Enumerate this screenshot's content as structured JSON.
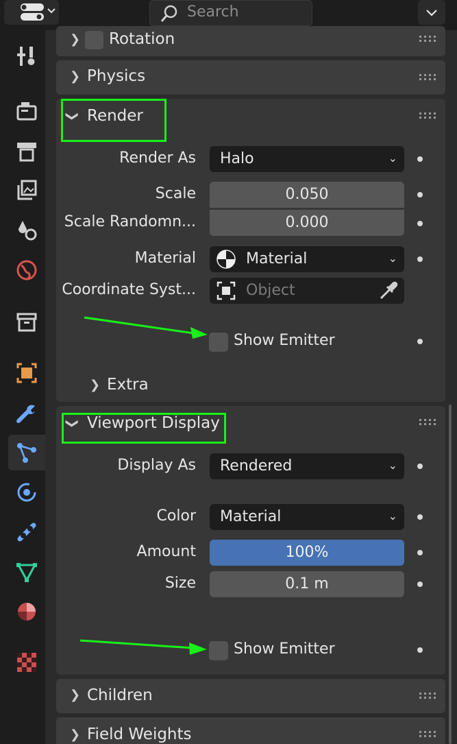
{
  "header": {
    "search_placeholder": "Search"
  },
  "tabs": [
    {
      "name": "tool"
    },
    {
      "name": "render"
    },
    {
      "name": "output"
    },
    {
      "name": "view-layer"
    },
    {
      "name": "scene"
    },
    {
      "name": "world"
    },
    {
      "name": "collection"
    },
    {
      "name": "object"
    },
    {
      "name": "modifiers"
    },
    {
      "name": "particles",
      "active": true
    },
    {
      "name": "physics"
    },
    {
      "name": "constraints"
    },
    {
      "name": "data"
    },
    {
      "name": "material"
    },
    {
      "name": "texture"
    }
  ],
  "panels": {
    "rotation": {
      "label": "Rotation"
    },
    "physics": {
      "label": "Physics"
    },
    "render": {
      "label": "Render",
      "render_as_label": "Render As",
      "render_as_value": "Halo",
      "scale_label": "Scale",
      "scale_value": "0.050",
      "scale_random_label": "Scale Randomn...",
      "scale_random_value": "0.000",
      "material_label": "Material",
      "material_value": "Material",
      "coord_label": "Coordinate Syst...",
      "coord_placeholder": "Object",
      "show_emitter_label": "Show Emitter",
      "show_emitter_checked": false,
      "extra_label": "Extra"
    },
    "viewport_display": {
      "label": "Viewport Display",
      "display_as_label": "Display As",
      "display_as_value": "Rendered",
      "color_label": "Color",
      "color_value": "Material",
      "amount_label": "Amount",
      "amount_value": "100%",
      "amount_fraction": 1.0,
      "size_label": "Size",
      "size_value": "0.1 m",
      "show_emitter_label": "Show Emitter",
      "show_emitter_checked": false
    },
    "children": {
      "label": "Children"
    },
    "field_weights": {
      "label": "Field Weights"
    }
  },
  "colors": {
    "annotation": "#19f019",
    "accent_blue": "#4772b3",
    "active_tab_icon": "#6aa9ff"
  }
}
